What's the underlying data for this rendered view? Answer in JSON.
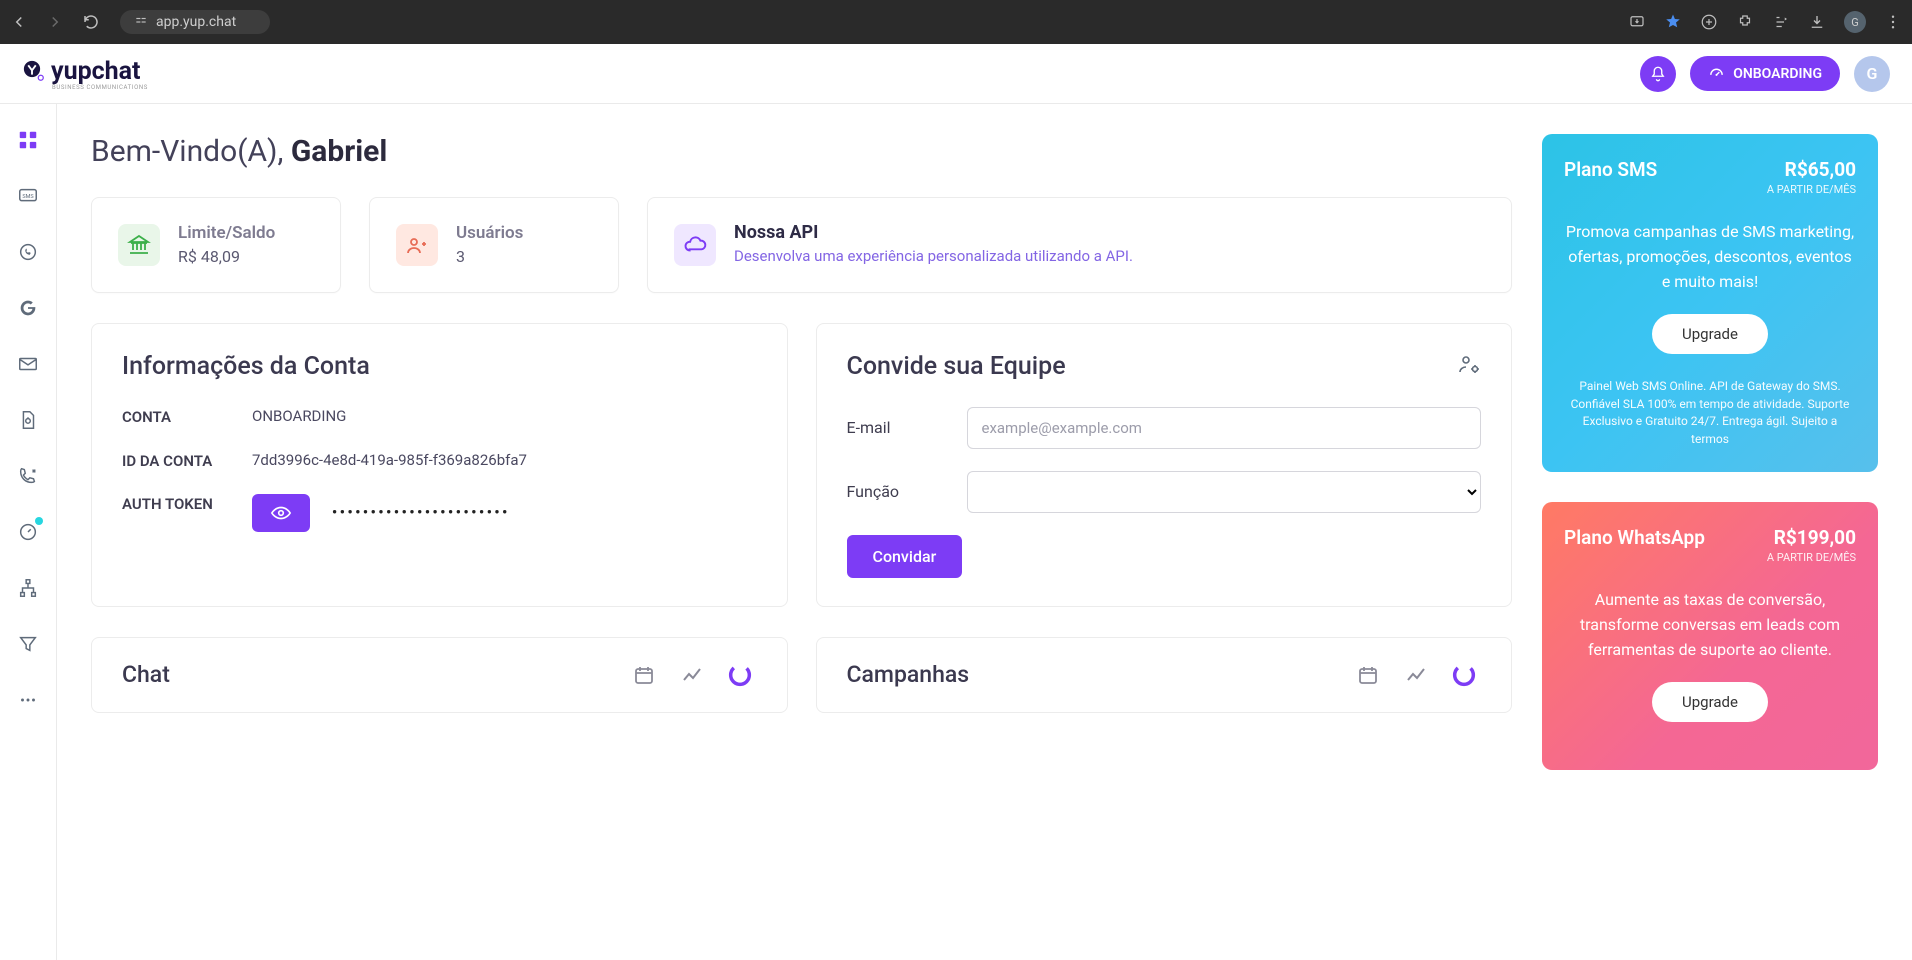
{
  "browser": {
    "url": "app.yup.chat",
    "avatar_letter": "G"
  },
  "header": {
    "logo_text": "yupchat",
    "logo_subtitle": "BUSINESS COMMUNICATIONS",
    "onboarding_label": "ONBOARDING",
    "avatar_letter": "G"
  },
  "sidebar": {
    "items": [
      {
        "id": "dashboard"
      },
      {
        "id": "sms"
      },
      {
        "id": "whatsapp"
      },
      {
        "id": "google"
      },
      {
        "id": "email"
      },
      {
        "id": "documents"
      },
      {
        "id": "phone"
      },
      {
        "id": "analytics"
      },
      {
        "id": "hierarchy"
      },
      {
        "id": "filter"
      },
      {
        "id": "more"
      }
    ]
  },
  "welcome": {
    "prefix": "Bem-Vindo(A), ",
    "name": "Gabriel"
  },
  "metrics": {
    "limit": {
      "title": "Limite/Saldo",
      "value": "R$ 48,09"
    },
    "users": {
      "title": "Usuários",
      "value": "3"
    },
    "api": {
      "title": "Nossa API",
      "desc": "Desenvolva uma experiência personalizada utilizando a API."
    }
  },
  "account_info": {
    "title": "Informações da Conta",
    "rows": {
      "conta_label": "CONTA",
      "conta_value": "ONBOARDING",
      "idconta_label": "ID DA CONTA",
      "idconta_value": "7dd3996c-4e8d-419a-985f-f369a826bfa7",
      "token_label": "AUTH TOKEN",
      "token_masked": "•••••••••••••••••••••••"
    }
  },
  "invite": {
    "title": "Convide sua Equipe",
    "email_label": "E-mail",
    "email_placeholder": "example@example.com",
    "role_label": "Função",
    "submit_label": "Convidar"
  },
  "charts": {
    "chat_title": "Chat",
    "campanhas_title": "Campanhas"
  },
  "plans": {
    "sms": {
      "name": "Plano SMS",
      "price": "R$65,00",
      "price_sub": "A PARTIR DE/MÊS",
      "desc": "Promova campanhas de SMS marketing, ofertas, promoções, descontos, eventos e muito mais!",
      "upgrade_label": "Upgrade",
      "footer": "Painel Web SMS Online. API de Gateway do SMS. Confiável SLA 100% em tempo de atividade. Suporte Exclusivo e Gratuito 24/7. Entrega ágil. Sujeito a termos"
    },
    "whatsapp": {
      "name": "Plano WhatsApp",
      "price": "R$199,00",
      "price_sub": "A PARTIR DE/MÊS",
      "desc": "Aumente as taxas de conversão, transforme conversas em leads com ferramentas de suporte ao cliente.",
      "upgrade_label": "Upgrade"
    }
  }
}
